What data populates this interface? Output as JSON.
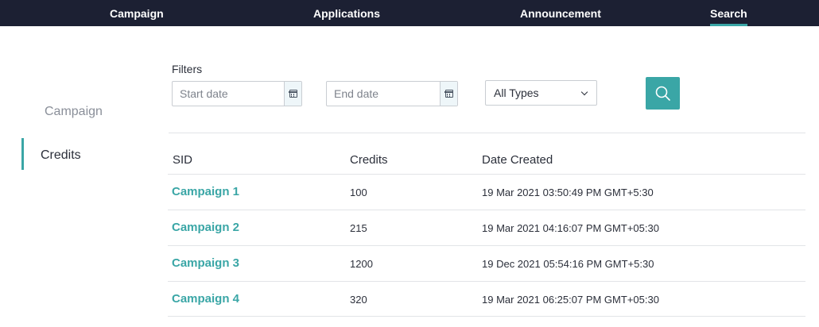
{
  "topnav": {
    "items": [
      {
        "label": "Campaign"
      },
      {
        "label": "Applications"
      },
      {
        "label": "Announcement"
      },
      {
        "label": "Search",
        "active": true
      }
    ]
  },
  "sidebar": {
    "items": [
      {
        "label": "Campaign"
      },
      {
        "label": "Credits",
        "active": true
      }
    ]
  },
  "filters": {
    "label": "Filters",
    "start_date_placeholder": "Start date",
    "end_date_placeholder": "End date",
    "type_selected": "All Types",
    "calendar_icon": "calendar-icon",
    "search_icon": "search-icon"
  },
  "table": {
    "headers": {
      "sid": "SID",
      "credits": "Credits",
      "date_created": "Date Created"
    },
    "rows": [
      {
        "sid": "Campaign 1",
        "credits": "100",
        "date_created": "19 Mar 2021 03:50:49 PM GMT+5:30"
      },
      {
        "sid": "Campaign 2",
        "credits": "215",
        "date_created": "19 Mar 2021 04:16:07 PM GMT+05:30"
      },
      {
        "sid": "Campaign 3",
        "credits": "1200",
        "date_created": "19 Dec 2021 05:54:16 PM GMT+5:30"
      },
      {
        "sid": "Campaign 4",
        "credits": "320",
        "date_created": "19 Mar 2021 06:25:07 PM GMT+05:30"
      }
    ]
  },
  "colors": {
    "nav_background": "#1c2033",
    "accent": "#3aa6a6",
    "text": "#2b2f3a",
    "muted_text": "#8a8f99",
    "border": "#c9cdd2"
  }
}
